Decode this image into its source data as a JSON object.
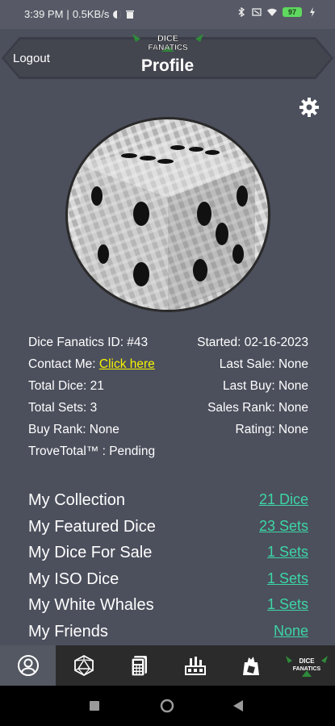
{
  "status_bar": {
    "time": "3:39 PM",
    "speed": "0.5KB/s",
    "battery": "97"
  },
  "header": {
    "logout_label": "Logout",
    "logo_line1": "DICE",
    "logo_line2": "FANATICS",
    "title": "Profile"
  },
  "icons": {
    "settings": "gear-icon",
    "avatar": "dice-avatar"
  },
  "info": {
    "id_label": "Dice Fanatics ID: #43",
    "started_label": "Started: 02-16-2023",
    "contact_label": "Contact Me: ",
    "contact_link": "Click here",
    "last_sale": "Last Sale: None",
    "total_dice": "Total Dice: 21",
    "last_buy": "Last Buy: None",
    "total_sets": "Total Sets: 3",
    "sales_rank": "Sales Rank: None",
    "buy_rank": "Buy Rank: None",
    "rating": "Rating: None",
    "trove_total": "TroveTotal™ : Pending"
  },
  "sections": [
    {
      "label": "My Collection",
      "value": "21 Dice"
    },
    {
      "label": "My Featured Dice",
      "value": "23 Sets"
    },
    {
      "label": "My Dice For Sale",
      "value": "1 Sets"
    },
    {
      "label": "My ISO Dice",
      "value": "1 Sets"
    },
    {
      "label": "My White Whales",
      "value": "1 Sets"
    },
    {
      "label": "My Friends",
      "value": "None"
    }
  ],
  "bottom_nav": [
    {
      "name": "profile-icon",
      "active": true
    },
    {
      "name": "d20-icon",
      "active": false
    },
    {
      "name": "calculator-icon",
      "active": false
    },
    {
      "name": "market-icon",
      "active": false
    },
    {
      "name": "dice-bag-icon",
      "active": false
    },
    {
      "name": "logo-icon",
      "active": false
    }
  ],
  "colors": {
    "background": "#4c4f5c",
    "link_green": "#3cd6a6",
    "contact_yellow": "#f5f500",
    "nav_bg": "#2b2b2b",
    "nav_active": "#545862"
  }
}
